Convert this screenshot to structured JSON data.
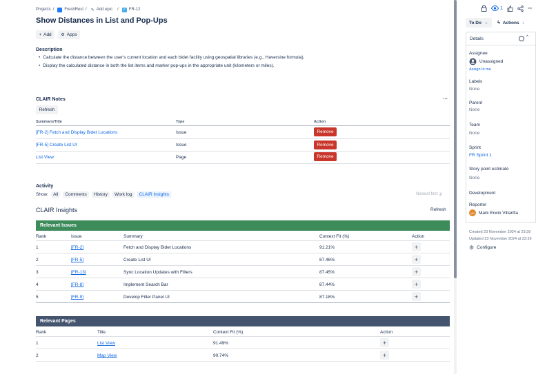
{
  "breadcrumb": {
    "projects": "Projects",
    "sep1": "/",
    "project": "FreshRest",
    "sep2": "/",
    "epic": "Add epic",
    "sep3": "/",
    "issue_key": "FR-12"
  },
  "header": {
    "title": "Show Distances in List and Pop-Ups",
    "add_label": "Add",
    "apps_label": "Apps"
  },
  "description": {
    "heading": "Description",
    "bullets": [
      "Calculate the distance between the user's current location and each bidet facility using geospatial libraries (e.g., Haversine formula).",
      "Display the calculated distance in both the list items and marker pop-ups in the appropriate unit (kilometers or miles)."
    ]
  },
  "clair_notes": {
    "heading": "CLAIR Notes",
    "refresh_label": "Refresh",
    "more": "···",
    "columns": [
      "Summary/Title",
      "Type",
      "Action"
    ],
    "rows": [
      {
        "title": "[FR-2] Fetch and Display Bidet Locations",
        "type": "Issue",
        "action": "Remove"
      },
      {
        "title": "[FR-5] Create List UI",
        "type": "Issue",
        "action": "Remove"
      },
      {
        "title": "List View",
        "type": "Page",
        "action": "Remove"
      }
    ]
  },
  "activity": {
    "heading": "Activity",
    "show_label": "Show:",
    "filters": [
      "All",
      "Comments",
      "History",
      "Work log",
      "CLAIR Insights"
    ],
    "sort_label": "Newest first"
  },
  "clair_insights": {
    "heading": "CLAIR Insights",
    "refresh_label": "Refresh",
    "issues": {
      "banner": "Relevant Issues",
      "banner_color": "#3d8a5b",
      "columns": [
        "Rank",
        "Issue",
        "Summary",
        "Context Fit (%)",
        "Action"
      ],
      "rows": [
        {
          "rank": "1",
          "issue": "[FR-2]",
          "summary": "Fetch and Display Bidet Locations",
          "fit": "91.21%"
        },
        {
          "rank": "2",
          "issue": "[FR-5]",
          "summary": "Create List UI",
          "fit": "87.46%"
        },
        {
          "rank": "3",
          "issue": "[FR-13]",
          "summary": "Sync Location Updates with Filters",
          "fit": "87.45%"
        },
        {
          "rank": "4",
          "issue": "[FR-8]",
          "summary": "Implement Search Bar",
          "fit": "87.44%"
        },
        {
          "rank": "5",
          "issue": "[FR-9]",
          "summary": "Develop Filter Panel UI",
          "fit": "87.18%"
        }
      ]
    },
    "pages": {
      "banner": "Relevant Pages",
      "banner_color": "#44546f",
      "columns": [
        "Rank",
        "Title",
        "Context Fit (%)",
        "Action"
      ],
      "rows": [
        {
          "rank": "1",
          "title": "List View",
          "fit": "91.49%"
        },
        {
          "rank": "2",
          "title": "Map View",
          "fit": "90.74%"
        }
      ]
    }
  },
  "toolbar": {
    "watch_count": "1"
  },
  "status": {
    "value": "To Do",
    "actions_label": "Actions"
  },
  "details": {
    "heading": "Details",
    "assignee_label": "Assignee",
    "assignee_value": "Unassigned",
    "assign_to_me": "Assign to me",
    "labels_label": "Labels",
    "labels_value": "None",
    "parent_label": "Parent",
    "parent_value": "None",
    "team_label": "Team",
    "team_value": "None",
    "sprint_label": "Sprint",
    "sprint_value": "FR Sprint 1",
    "story_label": "Story point estimate",
    "story_value": "None",
    "development_label": "Development",
    "reporter_label": "Reporter",
    "reporter_initials": "MV",
    "reporter_name": "Mark Erwin Villarifia"
  },
  "meta": {
    "created": "Created 23 November 2024 at 23:39",
    "updated": "Updated 23 November 2024 at 23:39",
    "configure": "Configure"
  }
}
